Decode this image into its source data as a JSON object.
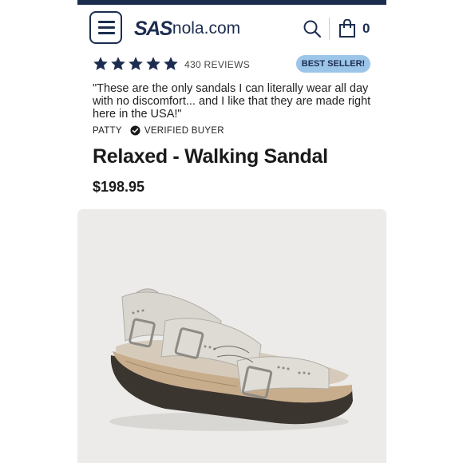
{
  "header": {
    "logo_primary": "SAS",
    "logo_secondary": "nola.com",
    "cart_count": "0",
    "icons": [
      "menu-icon",
      "search-icon",
      "shopping-bag-icon"
    ],
    "brand_color": "#1d2d50"
  },
  "product": {
    "rating_stars": 5,
    "reviews_label": "430 REVIEWS",
    "badge": "BEST SELLER!",
    "quote": "\"These are the only sandals I can literally wear all day with no discomfort... and I like that they are made right here in the USA!\"",
    "reviewer_name": "PATTY",
    "verified_label": "VERIFIED BUYER",
    "title": "Relaxed - Walking Sandal",
    "price": "$198.95",
    "star_color": "#1d2d50",
    "badge_color": "#9cc5ea"
  }
}
